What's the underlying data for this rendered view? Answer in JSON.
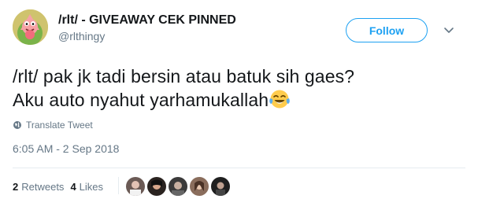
{
  "author": {
    "display_name": "/rlt/ - GIVEAWAY CEK PINNED",
    "handle": "@rlthingy",
    "avatar_icon": "patrick-star-avatar"
  },
  "follow_button": {
    "label": "Follow"
  },
  "menu": {
    "icon": "chevron-down-icon"
  },
  "tweet": {
    "line1": "/rlt/ pak jk tadi bersin atau batuk sih gaes?",
    "line2": "Aku auto nyahut yarhamukallah",
    "emoji": "face-with-tears-of-joy"
  },
  "translate": {
    "label": "Translate Tweet",
    "icon": "globe-icon"
  },
  "timestamp": "6:05 AM - 2 Sep 2018",
  "stats": {
    "retweets_count": "2",
    "retweets_label": "Retweets",
    "likes_count": "4",
    "likes_label": "Likes"
  },
  "likers": [
    {
      "name": "liker-avatar-1",
      "color": "#6b5a55"
    },
    {
      "name": "liker-avatar-2",
      "color": "#2a2320"
    },
    {
      "name": "liker-avatar-3",
      "color": "#3b3a3a"
    },
    {
      "name": "liker-avatar-4",
      "color": "#8a6d5c"
    },
    {
      "name": "liker-avatar-5",
      "color": "#1f1f1f"
    }
  ],
  "colors": {
    "accent": "#1da1f2",
    "text": "#14171a",
    "muted": "#657786",
    "divider": "#e6ecf0"
  }
}
